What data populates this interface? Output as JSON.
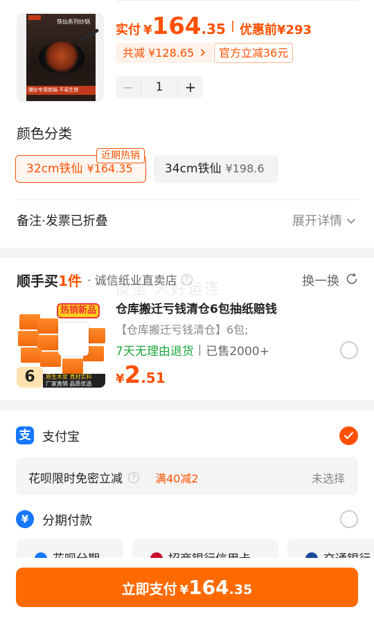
{
  "product": {
    "poster_title": "铁仙系列炒锅",
    "poster_banner": "爆炒专用铁锅  不易生锈",
    "price_label": "实付",
    "currency": "¥",
    "price_int": "164",
    "price_dec": ".35",
    "before_label": "优惠前",
    "before_price": "¥293",
    "saved_text": "共减 ¥128.65",
    "official_tag": "官方立减36元",
    "quantity": "1",
    "minus": "−",
    "plus": "+"
  },
  "color_section": {
    "title": "颜色分类",
    "hot_tag": "近期热销",
    "options": [
      {
        "label": "32cm铁仙",
        "price": "¥164.35",
        "selected": true
      },
      {
        "label": "34cm铁仙",
        "price": "¥198.6",
        "selected": false
      }
    ]
  },
  "remark": {
    "label": "备注·发票已折叠",
    "expand": "展开详情"
  },
  "add_on": {
    "logo_part1": "顺手买",
    "logo_part2": "1件",
    "shop": "· 诚信纸业直卖店",
    "swap": "换一换",
    "watermark": "傻笙 人好运连",
    "image_badge": "热销新品",
    "image_count": "6",
    "image_strip_1": "原生木浆 真材实料",
    "image_strip_2": "厂家直销 品质优选",
    "title": "仓库搬迁亏钱清仓6包抽纸赔钱",
    "desc": "【仓库搬迁亏钱清仓】6包;",
    "service": "7天无理由退货",
    "sold": "已售2000+",
    "currency": "¥",
    "price_int": "2",
    "price_dec": ".51"
  },
  "payment": {
    "alipay": "支付宝",
    "huabei_label": "花呗限时免密立减",
    "huabei_promo": "满40减2",
    "huabei_status": "未选择",
    "installment": "分期付款",
    "banks": [
      "花呗分期",
      "招商银行信用卡",
      "交通银行"
    ]
  },
  "pay_button": {
    "label": "立即支付",
    "currency": "¥",
    "price_int": "164",
    "price_dec": ".35"
  },
  "colors": {
    "accent": "#ff5000",
    "pay_button": "#ff6a00",
    "alipay_blue": "#1677ff",
    "green": "#1fa53e"
  }
}
